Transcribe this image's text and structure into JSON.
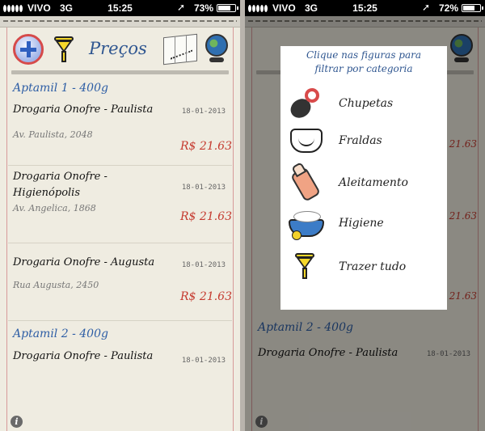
{
  "left_screen": {
    "status": {
      "carrier": "VIVO",
      "network": "3G",
      "time": "15:25",
      "battery": "73%",
      "battery_level": 0.73
    },
    "header": {
      "title": "Preços"
    },
    "sections": [
      {
        "title": "Aptamil 1 - 400g",
        "rows": [
          {
            "name": "Drogaria Onofre - Paulista",
            "date": "18-01-2013",
            "address": "Av. Paulista, 2048",
            "price": "R$ 21.63"
          },
          {
            "name": "Drogaria Onofre - Higienópolis",
            "date": "18-01-2013",
            "address": "Av. Angelica, 1868",
            "price": "R$ 21.63"
          },
          {
            "name": "Drogaria Onofre - Augusta",
            "date": "18-01-2013",
            "address": "Rua Augusta, 2450",
            "price": "R$ 21.63"
          }
        ]
      },
      {
        "title": "Aptamil 2 - 400g",
        "rows": [
          {
            "name": "Drogaria Onofre - Paulista",
            "date": "18-01-2013",
            "address": "",
            "price": ""
          }
        ]
      }
    ],
    "info": "i"
  },
  "right_screen": {
    "status": {
      "carrier": "VIVO",
      "network": "3G",
      "time": "15:25",
      "battery": "72%",
      "battery_level": 0.72
    },
    "background_rows": [
      {
        "price": "R$ 21.63"
      },
      {
        "price": "R$ 21.63"
      },
      {
        "price": "R$ 21.63"
      }
    ],
    "background_section": {
      "title": "Aptamil 2 - 400g",
      "row_name": "Drogaria Onofre - Paulista",
      "row_date": "18-01-2013"
    },
    "popup": {
      "title_line1": "Clique nas figuras para",
      "title_line2": "filtrar por categoria",
      "categories": [
        {
          "label": "Chupetas",
          "icon": "pacifier-icon"
        },
        {
          "label": "Fraldas",
          "icon": "diaper-icon"
        },
        {
          "label": "Aleitamento",
          "icon": "baby-bottle-icon"
        },
        {
          "label": "Higiene",
          "icon": "bathtub-icon"
        },
        {
          "label": "Trazer tudo",
          "icon": "funnel-icon"
        }
      ]
    },
    "info": "i"
  }
}
